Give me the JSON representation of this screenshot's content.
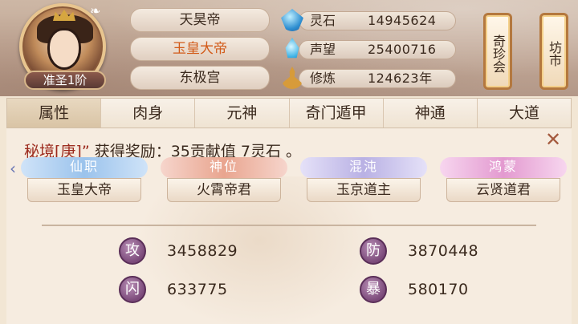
{
  "header": {
    "rank_badge": "准圣1阶",
    "titles": [
      {
        "label": "天昊帝",
        "active": false
      },
      {
        "label": "玉皇大帝",
        "active": true
      },
      {
        "label": "东极宫",
        "active": false
      }
    ],
    "resources": [
      {
        "icon": "spirit-stone-icon",
        "label": "灵石",
        "value": "14945624"
      },
      {
        "icon": "prestige-icon",
        "label": "声望",
        "value": "25400716"
      },
      {
        "icon": "cultivation-icon",
        "label": "修炼",
        "value": "124623年"
      }
    ],
    "side_buttons": [
      {
        "label": "奇珍会"
      },
      {
        "label": "坊市"
      }
    ]
  },
  "tabs": [
    {
      "label": "属性",
      "active": true
    },
    {
      "label": "肉身",
      "active": false
    },
    {
      "label": "元神",
      "active": false
    },
    {
      "label": "奇门遁甲",
      "active": false
    },
    {
      "label": "神通",
      "active": false
    },
    {
      "label": "大道",
      "active": false
    }
  ],
  "announcement": {
    "highlight": "秘境[庚]”",
    "text": " 获得奖励：35贡献值 7灵石 。"
  },
  "title_cards": [
    {
      "category": "仙职",
      "value": "玉皇大帝"
    },
    {
      "category": "神位",
      "value": "火霄帝君"
    },
    {
      "category": "混沌",
      "value": "玉京道主"
    },
    {
      "category": "鸿蒙",
      "value": "云贤道君"
    }
  ],
  "stats": [
    {
      "badge": "攻",
      "value": "3458829"
    },
    {
      "badge": "防",
      "value": "3870448"
    },
    {
      "badge": "闪",
      "value": "633775"
    },
    {
      "badge": "暴",
      "value": "580170"
    }
  ],
  "colors": {
    "active_title": "#d25a18",
    "announce_highlight": "#9c2b1e",
    "badge_purple": "#7b4a7a"
  }
}
